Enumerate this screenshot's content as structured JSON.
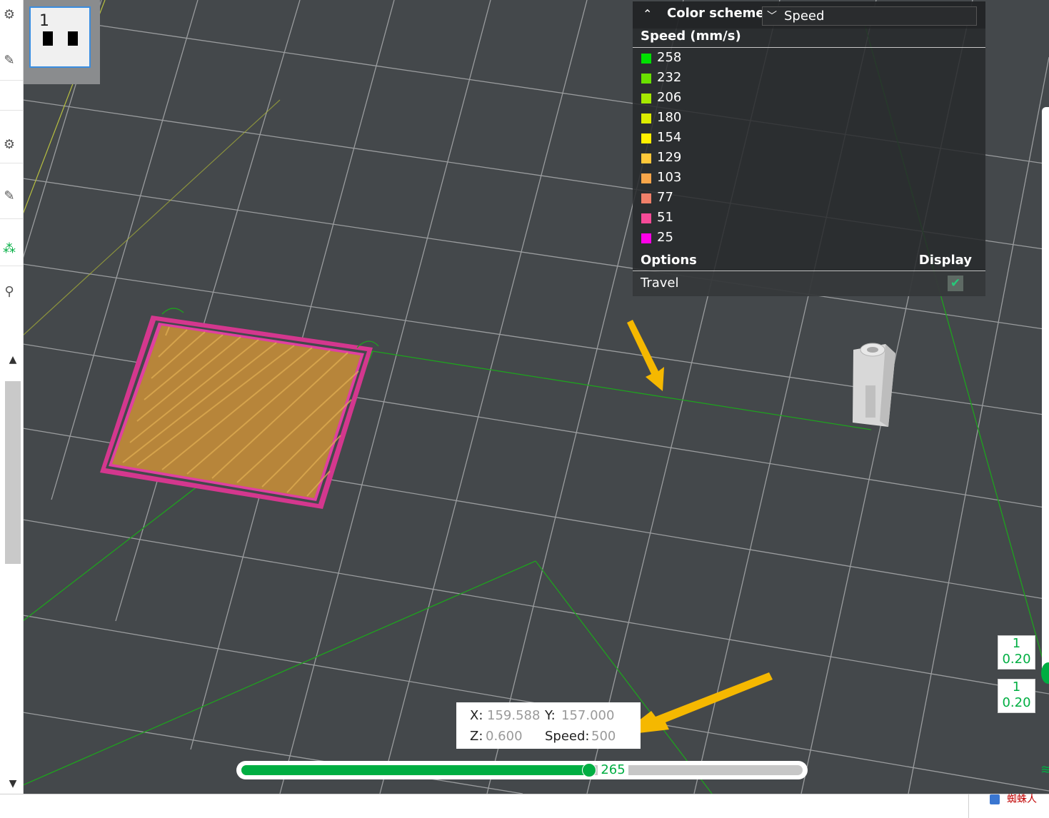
{
  "plate": {
    "number": "1"
  },
  "legend": {
    "header_title": "Color scheme",
    "scheme_value": "Speed",
    "section_title": "Speed (mm/s)",
    "items": [
      {
        "label": "258",
        "color": "#00e000"
      },
      {
        "label": "232",
        "color": "#6ae000"
      },
      {
        "label": "206",
        "color": "#a6e800"
      },
      {
        "label": "180",
        "color": "#dcec00"
      },
      {
        "label": "154",
        "color": "#ffef00"
      },
      {
        "label": "129",
        "color": "#ffc83a"
      },
      {
        "label": "103",
        "color": "#f8a64a"
      },
      {
        "label": "77",
        "color": "#f0806a"
      },
      {
        "label": "51",
        "color": "#f54b98"
      },
      {
        "label": "25",
        "color": "#ff00e8"
      }
    ],
    "options_title": "Options",
    "display_title": "Display",
    "options": [
      {
        "label": "Travel",
        "checked": true
      }
    ]
  },
  "tooltip": {
    "x_label": "X:",
    "x_value": "159.588",
    "y_label": "Y:",
    "y_value": "157.000",
    "z_label": "Z:",
    "z_value": "0.600",
    "speed_label": "Speed:",
    "speed_value": "500"
  },
  "move_slider": {
    "value": "265",
    "position_fraction": 0.62
  },
  "layer_slider": {
    "top_label": {
      "layer": "1",
      "height": "0.20"
    },
    "bottom_label": {
      "layer": "1",
      "height": "0.20"
    }
  },
  "taskbar": {
    "text": "蜘蛛人"
  },
  "colors": {
    "accent": "#00ae42",
    "viewport_bg": "#44484b",
    "travel_line": "#1ea21e",
    "annotation_arrow": "#f5b800",
    "brim": "#e040a0",
    "infill": "#c8963a"
  },
  "icons": [
    "gear-icon",
    "edit-icon",
    "supports-icon",
    "search-icon",
    "collapse-icon",
    "chevron-down-icon",
    "check-icon",
    "layers-icon"
  ]
}
